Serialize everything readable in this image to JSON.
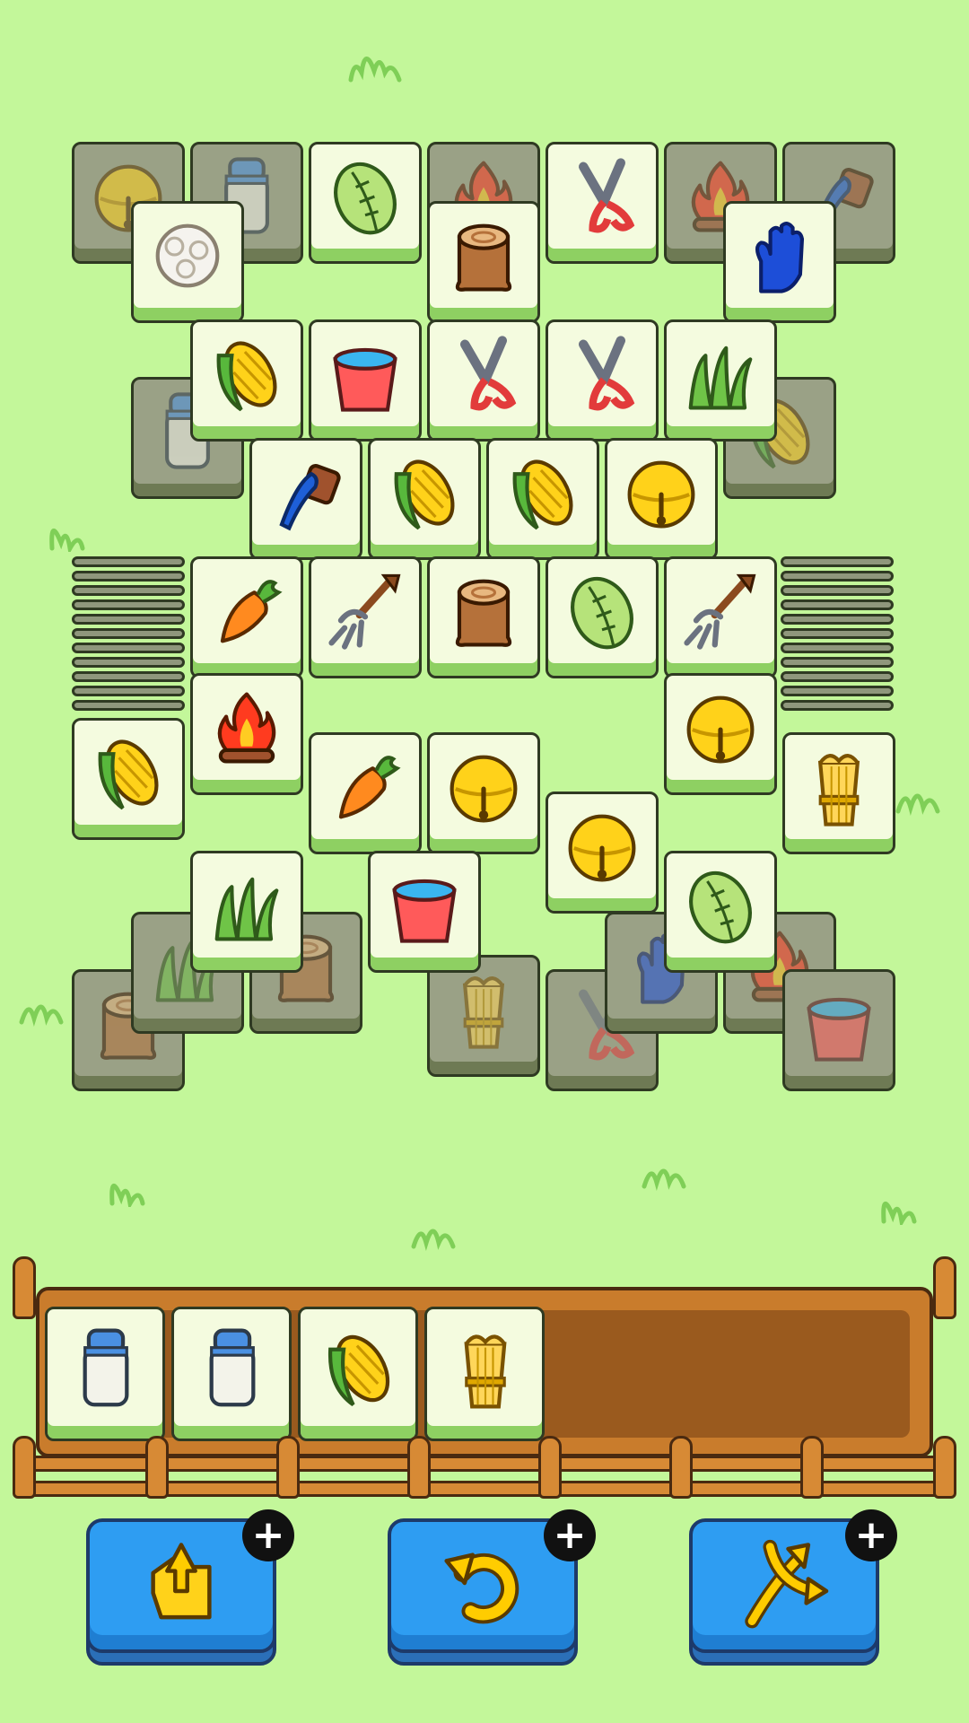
{
  "game": {
    "colors": {
      "background": "#c3f79a",
      "tile_free": "#f4fbdf",
      "tile_blocked": "#9aa186",
      "tray_wood": "#c97c2c",
      "booster_blue": "#2e9df2"
    },
    "tiles": [
      {
        "item": "bell",
        "free": false
      },
      {
        "item": "milk",
        "free": false
      },
      {
        "item": "cabbage",
        "free": true
      },
      {
        "item": "fire",
        "free": false
      },
      {
        "item": "shears",
        "free": true
      },
      {
        "item": "fire",
        "free": false
      },
      {
        "item": "brush",
        "free": false
      },
      {
        "item": "wool",
        "free": true
      },
      {
        "item": "stump",
        "free": true
      },
      {
        "item": "glove",
        "free": true
      },
      {
        "item": "corn",
        "free": true
      },
      {
        "item": "bucket",
        "free": true
      },
      {
        "item": "shears",
        "free": true
      },
      {
        "item": "shears",
        "free": true
      },
      {
        "item": "grass",
        "free": true
      },
      {
        "item": "milk",
        "free": false
      },
      {
        "item": "corn",
        "free": false
      },
      {
        "item": "brush",
        "free": true
      },
      {
        "item": "corn",
        "free": true
      },
      {
        "item": "corn",
        "free": true
      },
      {
        "item": "bell",
        "free": true
      },
      {
        "item": "carrot",
        "free": true
      },
      {
        "item": "pitchfork",
        "free": true
      },
      {
        "item": "stump",
        "free": true
      },
      {
        "item": "cabbage",
        "free": true
      },
      {
        "item": "pitchfork",
        "free": true
      },
      {
        "item": "corn",
        "free": true
      },
      {
        "item": "fire",
        "free": true
      },
      {
        "item": "bell",
        "free": true
      },
      {
        "item": "wheat",
        "free": true
      },
      {
        "item": "carrot",
        "free": true
      },
      {
        "item": "bell",
        "free": true
      },
      {
        "item": "bell",
        "free": true
      },
      {
        "item": "grass",
        "free": true
      },
      {
        "item": "bucket",
        "free": true
      },
      {
        "item": "cabbage",
        "free": true
      },
      {
        "item": "stump",
        "free": false
      },
      {
        "item": "grass",
        "free": false
      },
      {
        "item": "stump",
        "free": false
      },
      {
        "item": "wheat",
        "free": false
      },
      {
        "item": "shears",
        "free": false
      },
      {
        "item": "glove",
        "free": false
      },
      {
        "item": "fire",
        "free": false
      },
      {
        "item": "bucket",
        "free": false
      }
    ],
    "tray": {
      "capacity": 7,
      "slots": [
        "milk",
        "milk",
        "corn",
        "wheat"
      ]
    },
    "boosters": [
      {
        "name": "return",
        "icon": "return-icon",
        "plus": "+"
      },
      {
        "name": "undo",
        "icon": "undo-icon",
        "plus": "+"
      },
      {
        "name": "shuffle",
        "icon": "shuffle-icon",
        "plus": "+"
      }
    ]
  }
}
